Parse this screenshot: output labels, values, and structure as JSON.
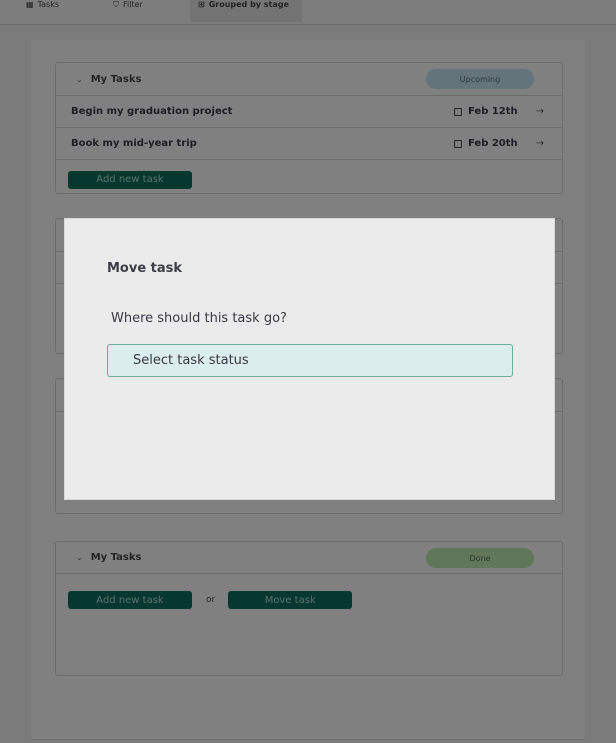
{
  "toolbar": {
    "tasks_icon": "table-icon",
    "tasks_label": "Tasks",
    "filter_icon": "filter-icon",
    "filter_label": "Filter",
    "group_icon": "grid-icon",
    "group_label": "Grouped by stage"
  },
  "groups": [
    {
      "title": "My Tasks",
      "stage": "Upcoming",
      "stage_color": "#bcdbe6",
      "tasks": [
        {
          "name": "Begin my graduation project",
          "date": "Feb 12th"
        },
        {
          "name": "Book my mid-year trip",
          "date": "Feb 20th"
        }
      ],
      "add_label": "Add new task"
    },
    {
      "title": "My Tasks",
      "stage": "Done",
      "stage_color": "#b6e3a8",
      "add_label": "Add new task",
      "or_label": "or",
      "move_label": "Move task"
    }
  ],
  "modal": {
    "title": "Move task",
    "question": "Where should this task go?",
    "select_placeholder": "Select task status"
  },
  "colors": {
    "accent": "#0e6b5a",
    "overlay": "rgba(0,0,0,0.47)"
  }
}
